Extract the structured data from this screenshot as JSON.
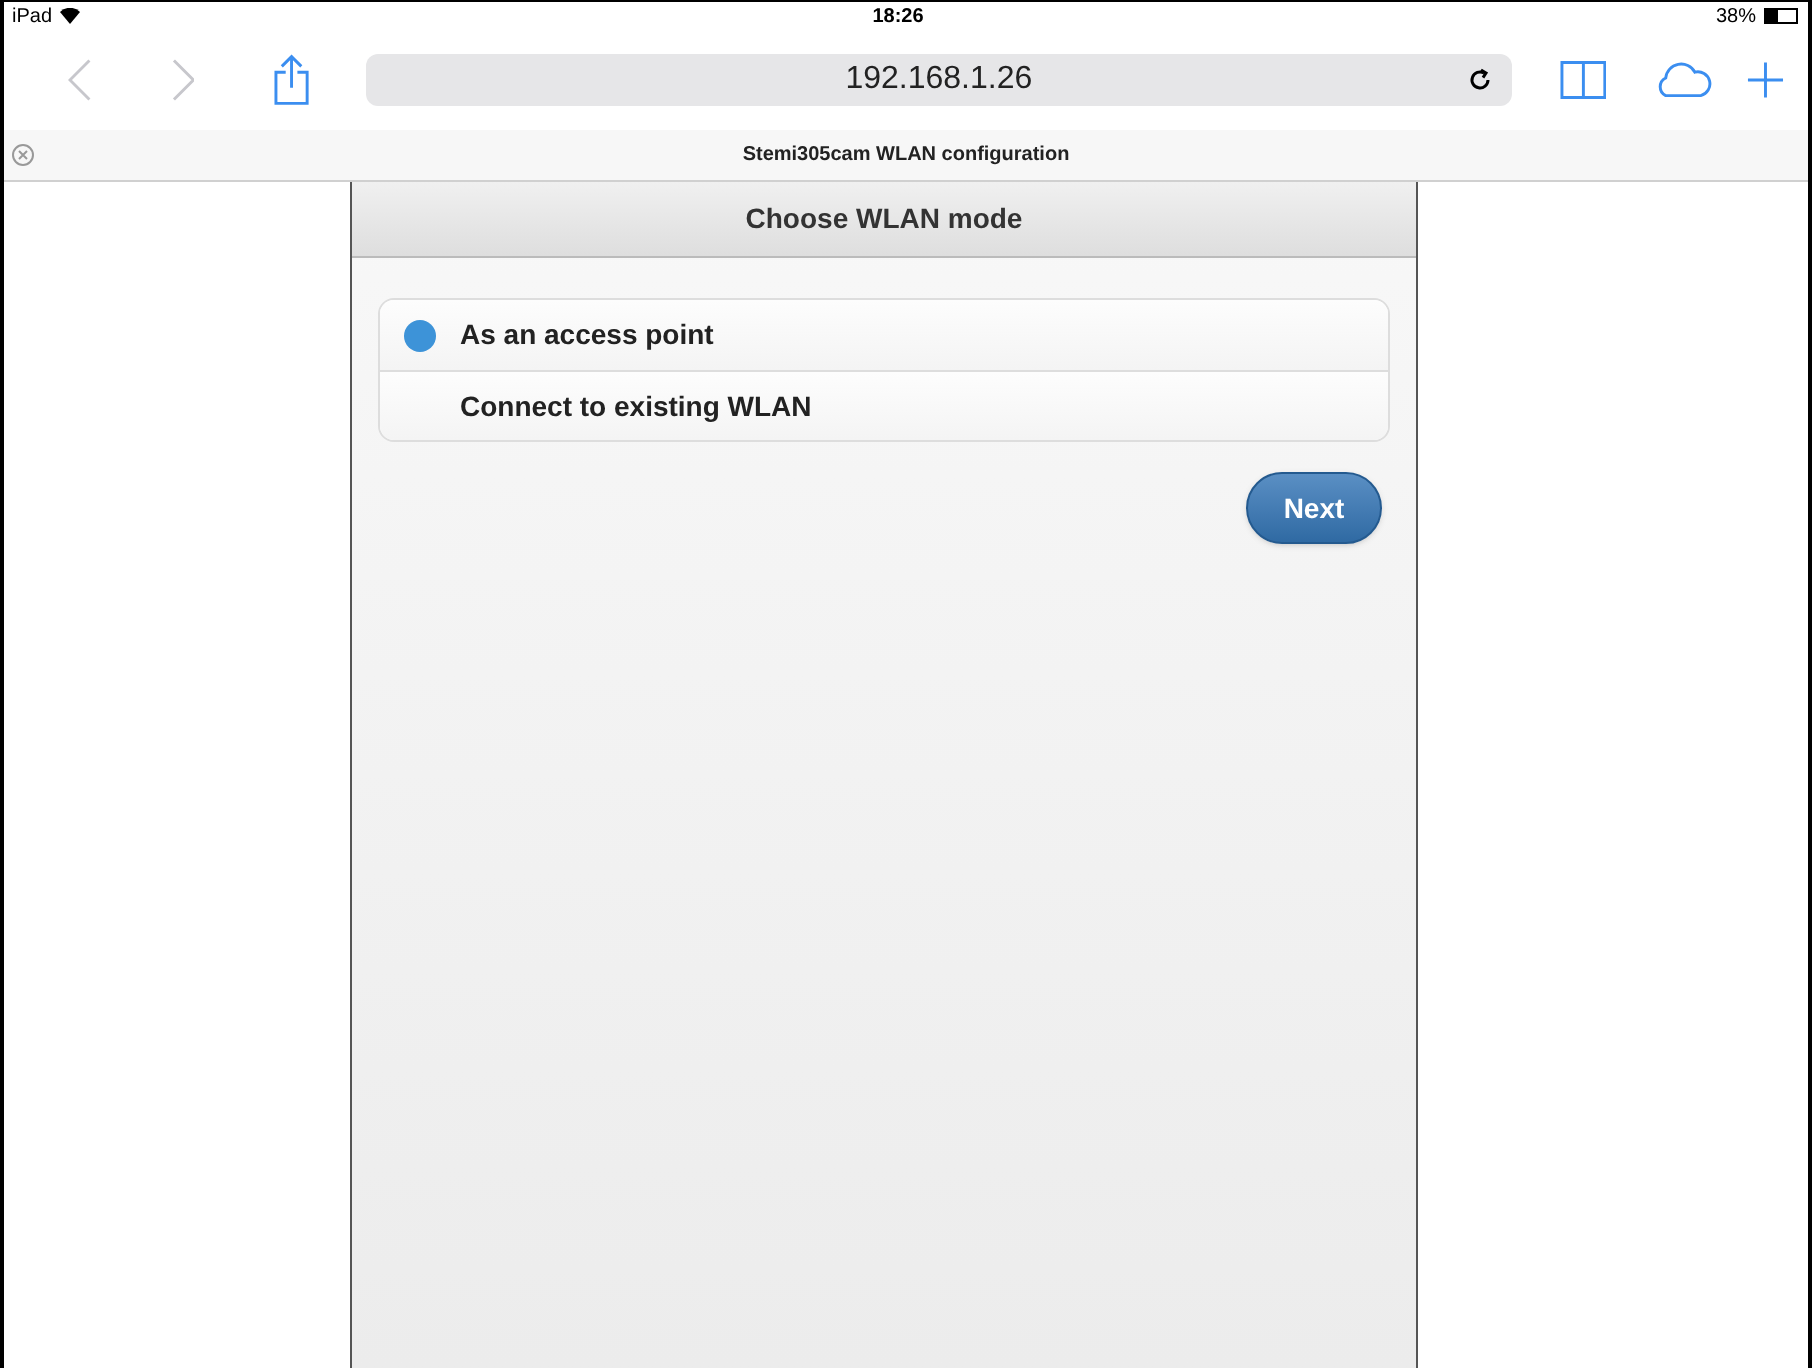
{
  "status_bar": {
    "device": "iPad",
    "time": "18:26",
    "battery": "38%"
  },
  "toolbar": {
    "url": "192.168.1.26"
  },
  "tab": {
    "title": "Stemi305cam WLAN configuration"
  },
  "page": {
    "header": "Choose WLAN mode",
    "options": [
      {
        "label": "As an access point",
        "selected": true
      },
      {
        "label": "Connect to existing WLAN",
        "selected": false
      }
    ],
    "button": "Next"
  }
}
